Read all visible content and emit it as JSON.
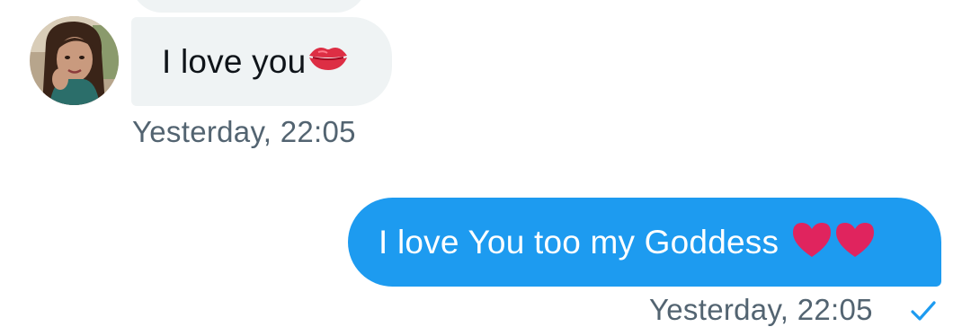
{
  "conversation": {
    "incoming": {
      "avatar_icon": "user-avatar-photo",
      "text": "I love you",
      "emoji_icon": "kiss-mark-icon",
      "timestamp": "Yesterday, 22:05"
    },
    "outgoing": {
      "text": "I love You too my Goddess",
      "emoji_icons": [
        "red-heart-icon",
        "red-heart-icon"
      ],
      "timestamp": "Yesterday, 22:05",
      "status_icon": "sent-check-icon"
    }
  },
  "colors": {
    "incoming_bubble": "#eff3f4",
    "outgoing_bubble": "#1d9bf0",
    "timestamp": "#536471",
    "heart": "#e0245e",
    "kiss": "#dd2e44"
  }
}
